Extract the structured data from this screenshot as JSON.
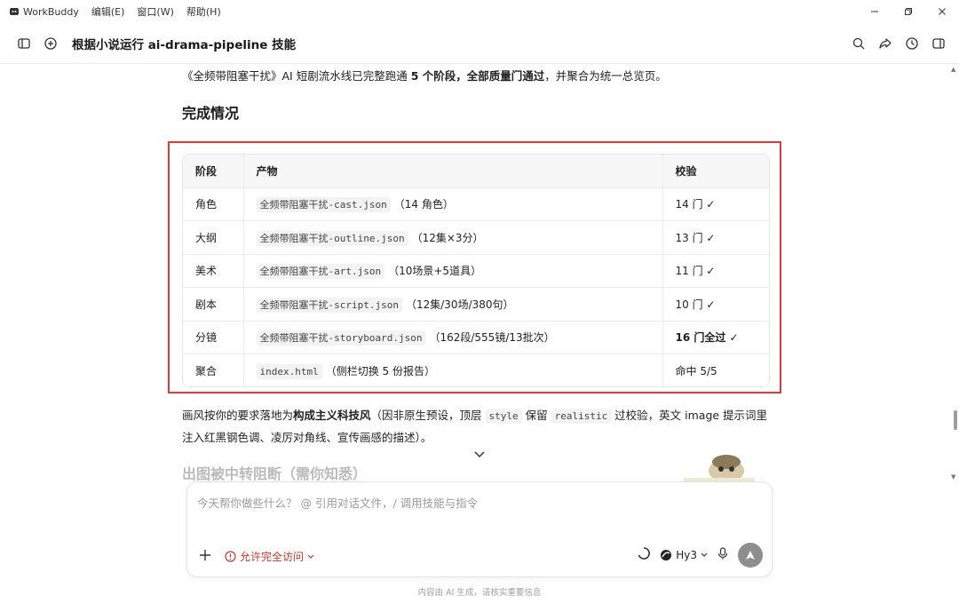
{
  "app": {
    "name": "WorkBuddy",
    "menus": [
      "编辑(E)",
      "窗口(W)",
      "帮助(H)"
    ]
  },
  "toolbar": {
    "title": "根据小说运行 ai-drama-pipeline 技能"
  },
  "content": {
    "intro_pre": "《全频带阻塞干扰》AI 短剧流水线已完整跑通 ",
    "intro_b1": "5 个阶段",
    "intro_sep": "，",
    "intro_b2": "全部质量门通过",
    "intro_post": "，并聚合为统一总览页。",
    "section_title": "完成情况",
    "table": {
      "headers": [
        "阶段",
        "产物",
        "校验"
      ],
      "rows": [
        {
          "stage": "角色",
          "file": "全频带阻塞干扰-cast.json",
          "note": "（14 角色）",
          "check": "14 门 ✓"
        },
        {
          "stage": "大纲",
          "file": "全频带阻塞干扰-outline.json",
          "note": "（12集×3分）",
          "check": "13 门 ✓"
        },
        {
          "stage": "美术",
          "file": "全频带阻塞干扰-art.json",
          "note": "（10场景+5道具）",
          "check": "11 门 ✓"
        },
        {
          "stage": "剧本",
          "file": "全频带阻塞干扰-script.json",
          "note": "（12集/30场/380句）",
          "check": "10 门 ✓"
        },
        {
          "stage": "分镜",
          "file": "全频带阻塞干扰-storyboard.json",
          "note": "（162段/555镜/13批次）",
          "check": "16 门全过 ✓"
        },
        {
          "stage": "聚合",
          "file": "index.html",
          "note": "（侧栏切换 5 份报告）",
          "check": "命中 5/5"
        }
      ]
    },
    "style_p1": "画风按你的要求落地为",
    "style_b1": "构成主义科技风",
    "style_p2": "（因非原生预设，顶层 ",
    "style_code1": "style",
    "style_p3": " 保留 ",
    "style_code2": "realistic",
    "style_p4": " 过校验，英文 image 提示词里注入红黑钢色调、凌厉对角线、宣传画感的描述）。",
    "next_heading": "出图被中转阻断（需你知悉）"
  },
  "input": {
    "placeholder": "今天帮你做些什么？ @ 引用对话文件，/ 调用技能与指令",
    "access_label": "允许完全访问",
    "model_label": "Hy3"
  },
  "footer": {
    "disclaimer": "内容由 AI 生成，请核实重要信息"
  },
  "colors": {
    "highlight": "#e53935",
    "access": "#c0392b",
    "send": "#8e8e8e"
  },
  "icons": [
    "sidebar-toggle-icon",
    "new-chat-icon",
    "search-icon",
    "share-icon",
    "history-icon",
    "panel-icon",
    "plus-icon",
    "warning-icon",
    "loading-icon",
    "model-logo-icon",
    "mic-icon",
    "send-icon"
  ]
}
